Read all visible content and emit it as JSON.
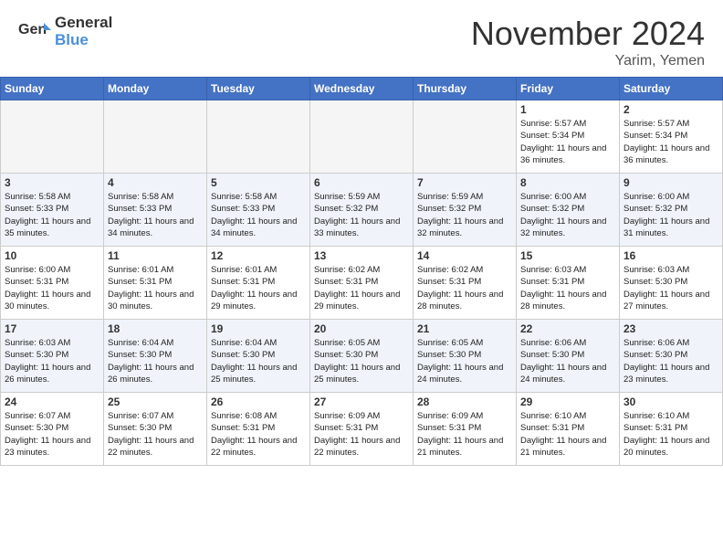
{
  "header": {
    "logo_general": "General",
    "logo_blue": "Blue",
    "month_title": "November 2024",
    "location": "Yarim, Yemen"
  },
  "weekdays": [
    "Sunday",
    "Monday",
    "Tuesday",
    "Wednesday",
    "Thursday",
    "Friday",
    "Saturday"
  ],
  "weeks": [
    [
      {
        "day": "",
        "empty": true
      },
      {
        "day": "",
        "empty": true
      },
      {
        "day": "",
        "empty": true
      },
      {
        "day": "",
        "empty": true
      },
      {
        "day": "",
        "empty": true
      },
      {
        "day": "1",
        "sunrise": "5:57 AM",
        "sunset": "5:34 PM",
        "daylight": "11 hours and 36 minutes."
      },
      {
        "day": "2",
        "sunrise": "5:57 AM",
        "sunset": "5:34 PM",
        "daylight": "11 hours and 36 minutes."
      }
    ],
    [
      {
        "day": "3",
        "sunrise": "5:58 AM",
        "sunset": "5:33 PM",
        "daylight": "11 hours and 35 minutes."
      },
      {
        "day": "4",
        "sunrise": "5:58 AM",
        "sunset": "5:33 PM",
        "daylight": "11 hours and 34 minutes."
      },
      {
        "day": "5",
        "sunrise": "5:58 AM",
        "sunset": "5:33 PM",
        "daylight": "11 hours and 34 minutes."
      },
      {
        "day": "6",
        "sunrise": "5:59 AM",
        "sunset": "5:32 PM",
        "daylight": "11 hours and 33 minutes."
      },
      {
        "day": "7",
        "sunrise": "5:59 AM",
        "sunset": "5:32 PM",
        "daylight": "11 hours and 32 minutes."
      },
      {
        "day": "8",
        "sunrise": "6:00 AM",
        "sunset": "5:32 PM",
        "daylight": "11 hours and 32 minutes."
      },
      {
        "day": "9",
        "sunrise": "6:00 AM",
        "sunset": "5:32 PM",
        "daylight": "11 hours and 31 minutes."
      }
    ],
    [
      {
        "day": "10",
        "sunrise": "6:00 AM",
        "sunset": "5:31 PM",
        "daylight": "11 hours and 30 minutes."
      },
      {
        "day": "11",
        "sunrise": "6:01 AM",
        "sunset": "5:31 PM",
        "daylight": "11 hours and 30 minutes."
      },
      {
        "day": "12",
        "sunrise": "6:01 AM",
        "sunset": "5:31 PM",
        "daylight": "11 hours and 29 minutes."
      },
      {
        "day": "13",
        "sunrise": "6:02 AM",
        "sunset": "5:31 PM",
        "daylight": "11 hours and 29 minutes."
      },
      {
        "day": "14",
        "sunrise": "6:02 AM",
        "sunset": "5:31 PM",
        "daylight": "11 hours and 28 minutes."
      },
      {
        "day": "15",
        "sunrise": "6:03 AM",
        "sunset": "5:31 PM",
        "daylight": "11 hours and 28 minutes."
      },
      {
        "day": "16",
        "sunrise": "6:03 AM",
        "sunset": "5:30 PM",
        "daylight": "11 hours and 27 minutes."
      }
    ],
    [
      {
        "day": "17",
        "sunrise": "6:03 AM",
        "sunset": "5:30 PM",
        "daylight": "11 hours and 26 minutes."
      },
      {
        "day": "18",
        "sunrise": "6:04 AM",
        "sunset": "5:30 PM",
        "daylight": "11 hours and 26 minutes."
      },
      {
        "day": "19",
        "sunrise": "6:04 AM",
        "sunset": "5:30 PM",
        "daylight": "11 hours and 25 minutes."
      },
      {
        "day": "20",
        "sunrise": "6:05 AM",
        "sunset": "5:30 PM",
        "daylight": "11 hours and 25 minutes."
      },
      {
        "day": "21",
        "sunrise": "6:05 AM",
        "sunset": "5:30 PM",
        "daylight": "11 hours and 24 minutes."
      },
      {
        "day": "22",
        "sunrise": "6:06 AM",
        "sunset": "5:30 PM",
        "daylight": "11 hours and 24 minutes."
      },
      {
        "day": "23",
        "sunrise": "6:06 AM",
        "sunset": "5:30 PM",
        "daylight": "11 hours and 23 minutes."
      }
    ],
    [
      {
        "day": "24",
        "sunrise": "6:07 AM",
        "sunset": "5:30 PM",
        "daylight": "11 hours and 23 minutes."
      },
      {
        "day": "25",
        "sunrise": "6:07 AM",
        "sunset": "5:30 PM",
        "daylight": "11 hours and 22 minutes."
      },
      {
        "day": "26",
        "sunrise": "6:08 AM",
        "sunset": "5:31 PM",
        "daylight": "11 hours and 22 minutes."
      },
      {
        "day": "27",
        "sunrise": "6:09 AM",
        "sunset": "5:31 PM",
        "daylight": "11 hours and 22 minutes."
      },
      {
        "day": "28",
        "sunrise": "6:09 AM",
        "sunset": "5:31 PM",
        "daylight": "11 hours and 21 minutes."
      },
      {
        "day": "29",
        "sunrise": "6:10 AM",
        "sunset": "5:31 PM",
        "daylight": "11 hours and 21 minutes."
      },
      {
        "day": "30",
        "sunrise": "6:10 AM",
        "sunset": "5:31 PM",
        "daylight": "11 hours and 20 minutes."
      }
    ]
  ]
}
